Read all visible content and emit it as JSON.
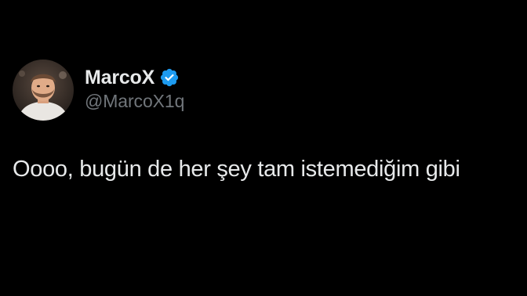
{
  "author": {
    "display_name": "MarcoX",
    "handle": "@MarcoX1q",
    "verified": true,
    "avatar_icon": "user-avatar-photo",
    "verified_icon": "verified-badge-icon"
  },
  "tweet": {
    "text": "Oooo, bugün de her şey tam istemediğim gibi"
  },
  "colors": {
    "background": "#000000",
    "primary_text": "#e7e9ea",
    "secondary_text": "#71767b",
    "verified_blue": "#1d9bf0"
  }
}
